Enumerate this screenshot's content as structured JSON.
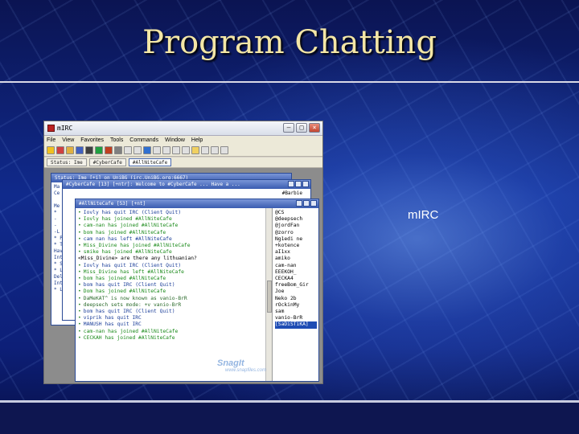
{
  "slide": {
    "title": "Program Chatting",
    "caption": "mIRC"
  },
  "app": {
    "title": "mIRC",
    "menu": [
      "File",
      "View",
      "Favorites",
      "Tools",
      "Commands",
      "Window",
      "Help"
    ],
    "switchbar": [
      "Status: Ime",
      "#CyberCafe",
      "#AllNiteCafe"
    ],
    "windows": {
      "status_title": "Status: Ime [+i] on UniBG (irc.UniBG.org:6667)",
      "cybercafe_title": "#CyberCafe [13] [+ntr]: Welcome to #CyberCafe ... Have a ...",
      "cybercafe_topic": "#Barbie",
      "allnite_title": "#AllNiteCafe [53] [+nt]"
    },
    "background_lines": [
      "Ma",
      "Ce",
      "",
      "Me",
      "*",
      "-",
      "-",
      "-L",
      "* Pe",
      "* To",
      "Have",
      "Into",
      "* Sl",
      "* Lo",
      "Del",
      "Int",
      "* Lo"
    ],
    "chat_lines": [
      {
        "type": "quit",
        "text": "Iovly has quit IRC (Client Quit)"
      },
      {
        "type": "join",
        "text": "Iovly has joined #AllNiteCafe"
      },
      {
        "type": "join",
        "text": "cam-nan has joined #AllNiteCafe"
      },
      {
        "type": "join",
        "text": "bom has joined #AllNiteCafe"
      },
      {
        "type": "quit",
        "text": "cam nan has left #AllNiteCafe"
      },
      {
        "type": "join",
        "text": "Miss_Divine has joined #AllNiteCafe"
      },
      {
        "type": "join",
        "text": "smike has joined #AllNiteCafe"
      },
      {
        "type": "msg",
        "text": "<Miss_Divine> are there any lithuanian?"
      },
      {
        "type": "quit",
        "text": "Iovly has quit IRC (Client Quit)"
      },
      {
        "type": "join",
        "text": "Miss_Divine has left #AllNiteCafe"
      },
      {
        "type": "join",
        "text": "bom has joined #AllNiteCafe"
      },
      {
        "type": "quit",
        "text": "bom has quit IRC (Client Quit)"
      },
      {
        "type": "join",
        "text": "Dom has joined #AllNiteCafe"
      },
      {
        "type": "nick",
        "text": "DaMeKAT^ is now known as vanio-BrR"
      },
      {
        "type": "mode",
        "text": "deepsech sets mode: +v vanio-BrR"
      },
      {
        "type": "quit",
        "text": "bom has quit IRC (Client Quit)"
      },
      {
        "type": "quit",
        "text": "viprik has quit IRC"
      },
      {
        "type": "quit",
        "text": "MANUSH has quit IRC"
      },
      {
        "type": "join",
        "text": "cam-nan has joined #AllNiteCafe"
      },
      {
        "type": "join",
        "text": "CECKAH has joined #AllNiteCafe"
      }
    ],
    "nicks": [
      "@CS",
      "@deepsech",
      "@jordFan",
      "@zorro",
      "Ng1edi ne",
      "+kotence",
      "aI1xx",
      "amiko",
      "cam-nan",
      "EEEKOH_",
      "CECKA4",
      "freeBom_Gir",
      "Joe",
      "Neko 2b",
      "rOckinMy",
      "sam",
      "vanio-BrR",
      "[SaDiSTiKA]"
    ],
    "selected_nick": "[SaDiSTiKA]",
    "watermark": "SnagIt",
    "watermark_url": "www.snapfiles.com"
  }
}
